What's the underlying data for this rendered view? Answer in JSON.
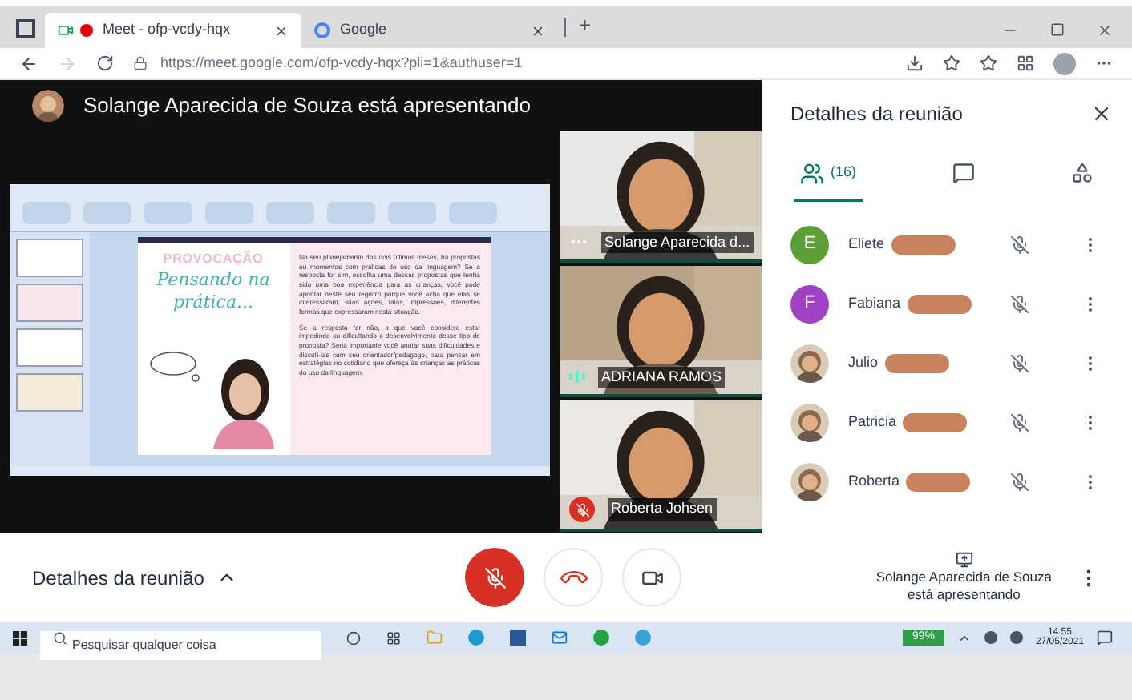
{
  "browser": {
    "tabs": [
      {
        "title": "Meet - ofp-vcdy-hqx",
        "kind": "meet",
        "selected": true
      },
      {
        "title": "Google",
        "kind": "google",
        "selected": false
      }
    ],
    "new_tab_label": "+",
    "url_host": "https://meet.google.com",
    "url_path": "/ofp-vcdy-hqx?pli=1&authuser=1"
  },
  "presenter_banner": "Solange Aparecida de Souza está apresentando",
  "slide": {
    "heading": "PROVOCAÇÃO",
    "title_line1": "Pensando na",
    "title_line2": "prática...",
    "paragraphs": [
      "No seu planejamento dos dois últimos meses, há propostas ou momentos com práticas do uso da linguagem? Se a resposta for sim, escolha uma dessas propostas que tenha sido uma boa experiência para as crianças, você pode apontar neste seu registro porque você acha que elas se interessaram, suas ações, falas, impressões, diferentes formas que expressaram nesta situação.",
      "Se a resposta for não, o que você considera estar impedindo ou dificultando o desenvolvimento desse tipo de proposta? Seria importante você anotar suas dificuldades e discutí-las com seu orientador/pedagogo, para pensar em estratégias no cotidiano que ofereça às crianças as práticas do uso da linguagem."
    ]
  },
  "tiles": [
    {
      "name": "Solange Aparecida d...",
      "kind": "more"
    },
    {
      "name": "ADRIANA RAMOS",
      "kind": "speaking"
    },
    {
      "name": "Roberta Johsen",
      "kind": "muted"
    }
  ],
  "panel": {
    "title": "Detalhes da reunião",
    "tabs": [
      {
        "kind": "people",
        "label": "(16)",
        "selected": true
      },
      {
        "kind": "chat",
        "selected": false
      },
      {
        "kind": "activities",
        "selected": false
      }
    ],
    "participants": [
      {
        "name": "Eliete",
        "kind": "letter",
        "initial": "E",
        "color": "#5e9e37",
        "redacted": true
      },
      {
        "name": "Fabiana",
        "kind": "letter",
        "initial": "F",
        "color": "#a142c4",
        "redacted": true
      },
      {
        "name": "Julio",
        "redacted": true
      },
      {
        "name": "Patricia",
        "redacted": true
      },
      {
        "name": "Roberta",
        "redacted": true
      }
    ]
  },
  "bottom": {
    "details": "Detalhes da reunião",
    "mic_on": false,
    "presenting_line1": "Solange Aparecida de Souza",
    "presenting_line2": "está apresentando"
  },
  "taskbar": {
    "search_placeholder": "Pesquisar qualquer coisa",
    "battery": "99%",
    "time": "14:55",
    "date": "27/05/2021"
  }
}
